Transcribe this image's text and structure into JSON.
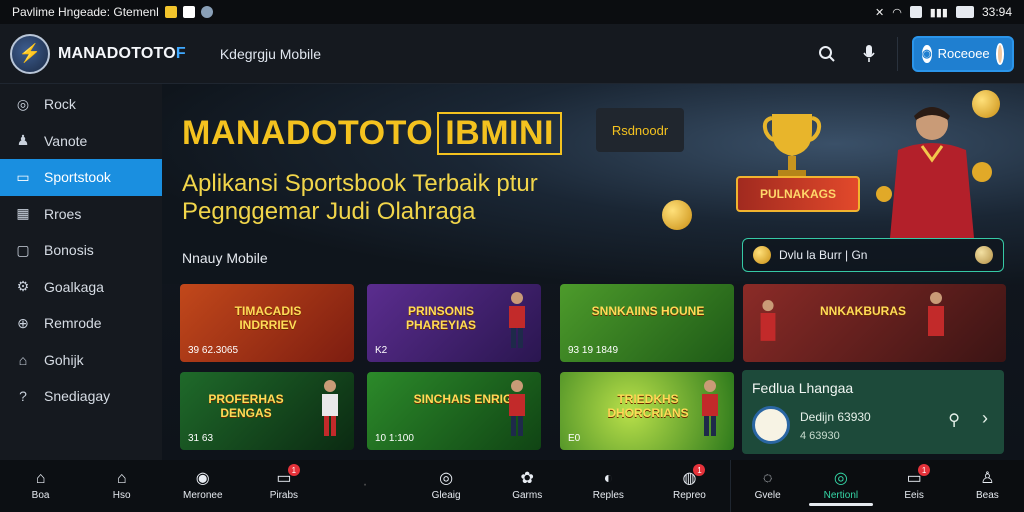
{
  "status_bar": {
    "left_text": "Pavlime Hngeade: Gtemenl",
    "right_text": "33:94"
  },
  "header": {
    "brand_main": "MANADOTOTO",
    "brand_accent": "F",
    "subtitle": "Kdegrgju Mobile",
    "account_label": "Roceoee"
  },
  "sidebar": {
    "items": [
      {
        "label": "Rock",
        "icon": "home-icon"
      },
      {
        "label": "Vanote",
        "icon": "user-icon"
      },
      {
        "label": "Sportstook",
        "icon": "monitor-icon",
        "active": true
      },
      {
        "label": "Rroes",
        "icon": "grid-icon"
      },
      {
        "label": "Bonosis",
        "icon": "bonus-icon"
      },
      {
        "label": "Goalkaga",
        "icon": "settings-icon"
      },
      {
        "label": "Remrode",
        "icon": "globe-icon"
      },
      {
        "label": "Gohijk",
        "icon": "bag-icon"
      },
      {
        "label": "Snediagay",
        "icon": "help-icon"
      }
    ]
  },
  "hero": {
    "title": "MANADOTOTO",
    "title_box": "IBMINI",
    "chip": "Rsdnoodr",
    "subtitle_line1": "Aplikansi Sportsbook Terbaik ptur",
    "subtitle_line2": "Pegnggemar Judi Olahraga",
    "note": "Nnauy Mobile",
    "promo_text": "Dvlu la Burr | Gn",
    "art_badge": "PULNAKAGS"
  },
  "cards": [
    {
      "title": "TIMACADIS INDRRIEV",
      "meta": "39 62.3065",
      "tag": ""
    },
    {
      "title": "PRINSONIS PHAREYIAS",
      "meta": "K2",
      "tag": ""
    },
    {
      "title": "SNNKAIINS HOUNE",
      "meta": "93 19 1849",
      "tag": ""
    },
    {
      "title": "NNKAKBURAS",
      "meta": "",
      "tag": ""
    },
    {
      "title": "PROFERHAS DENGAS",
      "meta": "31 63",
      "tag": ""
    },
    {
      "title": "SINCHAIS ENRIGE",
      "meta": "10 1:100",
      "tag": ""
    },
    {
      "title": "TRIEDKHS DHORCRIANS",
      "meta": "E0",
      "tag": ""
    }
  ],
  "featured": {
    "title": "Fedlua Lhangaa",
    "line1": "Dedijn  63930",
    "line2": "4  63930"
  },
  "bottom_nav": {
    "left": [
      {
        "label": "Boa",
        "icon": "home-filled-icon"
      },
      {
        "label": "Hso",
        "icon": "home-outline-icon"
      },
      {
        "label": "Meronee",
        "icon": "casino-icon"
      },
      {
        "label": "Pirabs",
        "icon": "chat-icon",
        "badge": "1"
      },
      {
        "label": "",
        "icon": "dots-icon"
      },
      {
        "label": "Gleaig",
        "icon": "coupon-icon"
      },
      {
        "label": "Garms",
        "icon": "games-icon"
      },
      {
        "label": "Reples",
        "icon": "replay-icon"
      },
      {
        "label": "Repreo",
        "icon": "profile-icon",
        "badge": "1"
      }
    ],
    "right": [
      {
        "label": "Gvele",
        "icon": "search-icon"
      },
      {
        "label": "Nertionl",
        "icon": "nav-icon",
        "active": true
      },
      {
        "label": "Eeis",
        "icon": "inbox-icon",
        "badge": "1"
      },
      {
        "label": "Beas",
        "icon": "person-icon"
      }
    ]
  }
}
